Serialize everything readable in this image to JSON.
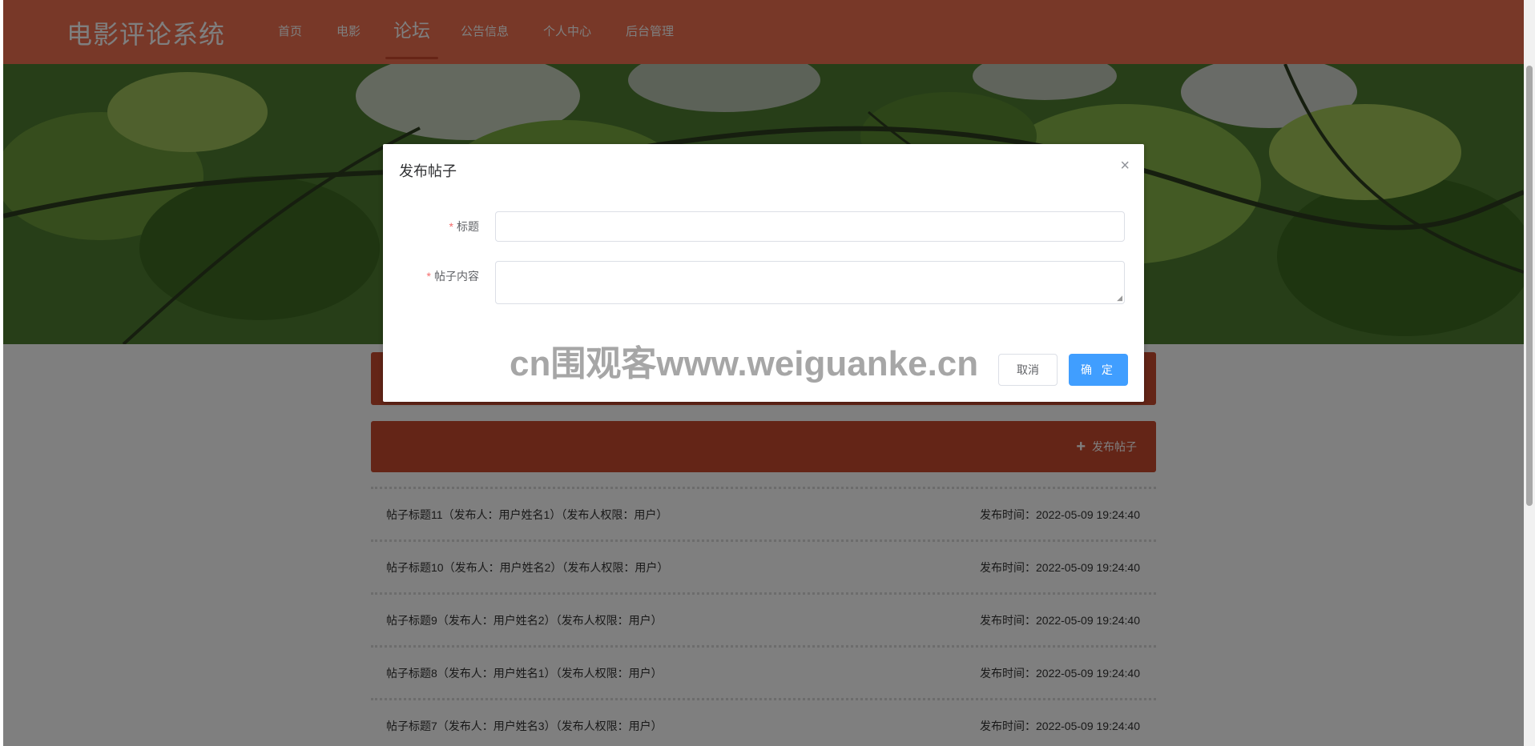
{
  "header": {
    "logo": "电影评论系统",
    "nav": [
      "首页",
      "电影",
      "论坛",
      "公告信息",
      "个人中心",
      "后台管理"
    ],
    "active_nav": "论坛"
  },
  "forum": {
    "publish_button": "发布帖子",
    "posts": [
      {
        "title": "帖子标题11（发布人：用户姓名1）（发布人权限：用户）",
        "time": "发布时间：2022-05-09 19:24:40"
      },
      {
        "title": "帖子标题10（发布人：用户姓名2）（发布人权限：用户）",
        "time": "发布时间：2022-05-09 19:24:40"
      },
      {
        "title": "帖子标题9（发布人：用户姓名2）（发布人权限：用户）",
        "time": "发布时间：2022-05-09 19:24:40"
      },
      {
        "title": "帖子标题8（发布人：用户姓名1）（发布人权限：用户）",
        "time": "发布时间：2022-05-09 19:24:40"
      },
      {
        "title": "帖子标题7（发布人：用户姓名3）（发布人权限：用户）",
        "time": "发布时间：2022-05-09 19:24:40"
      }
    ]
  },
  "dialog": {
    "title": "发布帖子",
    "close_icon": "×",
    "fields": {
      "title_label": "标题",
      "title_value": "",
      "content_label": "帖子内容",
      "content_value": "",
      "required_mark": "*"
    },
    "cancel": "取消",
    "confirm": "确 定"
  },
  "watermark": "cn围观客www.weiguanke.cn",
  "colors": {
    "header": "#f07050",
    "accent_bar": "#c94a2e",
    "primary_button": "#409eff"
  }
}
